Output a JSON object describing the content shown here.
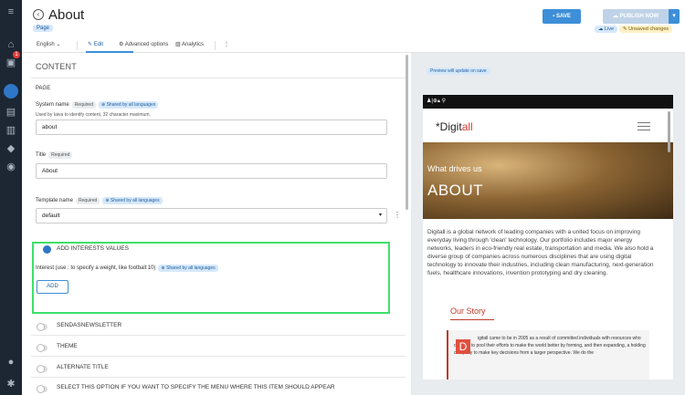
{
  "header": {
    "title": "About",
    "page_tag": "Page",
    "save_label": "SAVE",
    "publish_label": "PUBLISH NOW",
    "live_label": "Live",
    "unsaved_label": "Unsaved changes"
  },
  "tabs": {
    "language": "English",
    "edit": "Edit",
    "advanced": "Advanced options",
    "analytics": "Analytics"
  },
  "content": {
    "section_title": "CONTENT",
    "page_label": "PAGE",
    "system_name": {
      "label": "System name",
      "required": "Required",
      "shared": "Shared by all languages",
      "help": "Used by Iaiva to identify content, 32 character maximum.",
      "value": "about"
    },
    "title_field": {
      "label": "Title",
      "required": "Required",
      "value": "About"
    },
    "template": {
      "label": "Template name",
      "required": "Required",
      "shared": "Shared by all languages",
      "value": "default"
    },
    "interests": {
      "toggle_label": "ADD INTERESTS VALUES",
      "field_label": "Interest (use : to specify a weight, like football:10)",
      "shared": "Shared by all languages",
      "add_label": "ADD"
    },
    "toggles": [
      "SENDASNEWSLETTER",
      "THEME",
      "ALTERNATE TITLE",
      "SELECT THIS OPTION IF YOU WANT TO SPECIFY THE MENU WHERE THIS ITEM SHOULD APPEAR"
    ]
  },
  "preview": {
    "note": "Preview will update on save",
    "logo_prefix": "*Digit",
    "logo_suffix": "all",
    "hero_sub": "What drives us",
    "hero_title": "ABOUT",
    "paragraph": "Digitall is a global network of leading companies with a united focus on improving everyday living through 'clean' technology. Our portfolio includes major energy networks, leaders in eco-friendly real estate, transportation and media. We also hold a diverse group of companies across numerous disciplines that are using digital technology to innovate their industries, including clean manufacturing, next-generation fuels, healthcare innovations, invention prototyping and dry cleaning.",
    "story_title": "Our Story",
    "dropcap": "D",
    "story_text": "igitall came to be in 2005 as a result of committed individuals with resources who decided to pool their efforts to make the world better by forming, and then expanding, a holding company to make key decisions from a larger perspective. We do the"
  }
}
